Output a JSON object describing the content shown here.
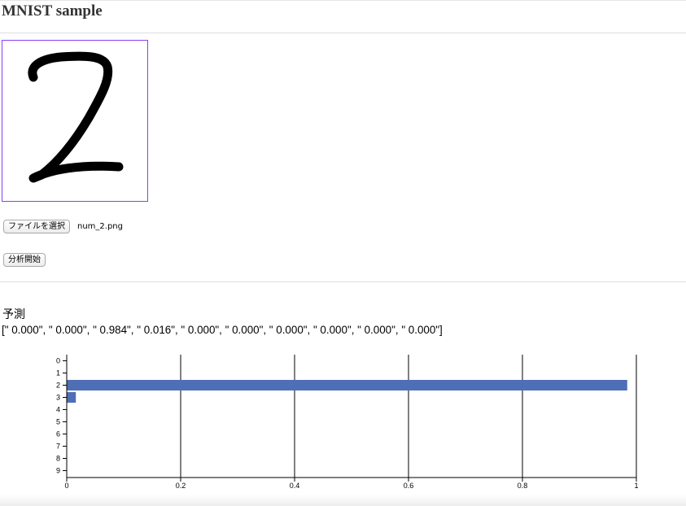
{
  "page": {
    "title": "MNIST sample"
  },
  "file_input": {
    "button_label": "ファイルを選択",
    "file_name": "num_2.png"
  },
  "analyze_button_label": "分析開始",
  "prediction": {
    "heading": "予測",
    "probabilities_text": "[\" 0.000\", \" 0.000\", \" 0.984\", \" 0.016\", \" 0.000\", \" 0.000\", \" 0.000\", \" 0.000\", \" 0.000\", \" 0.000\"]"
  },
  "preview": {
    "icon": "handwritten-digit-2-image",
    "border_color": "#8a3ff0"
  },
  "colors": {
    "bar": "#4e6fb5",
    "grid": "#000000"
  },
  "chart_data": {
    "type": "bar",
    "orientation": "horizontal",
    "categories": [
      "0",
      "1",
      "2",
      "3",
      "4",
      "5",
      "6",
      "7",
      "8",
      "9"
    ],
    "values": [
      0.0,
      0.0,
      0.984,
      0.016,
      0.0,
      0.0,
      0.0,
      0.0,
      0.0,
      0.0
    ],
    "x_ticks": [
      "0",
      "0.2",
      "0.4",
      "0.6",
      "0.8",
      "1"
    ],
    "xlim": [
      0,
      1
    ],
    "grid": true,
    "title": "",
    "xlabel": "",
    "ylabel": ""
  }
}
